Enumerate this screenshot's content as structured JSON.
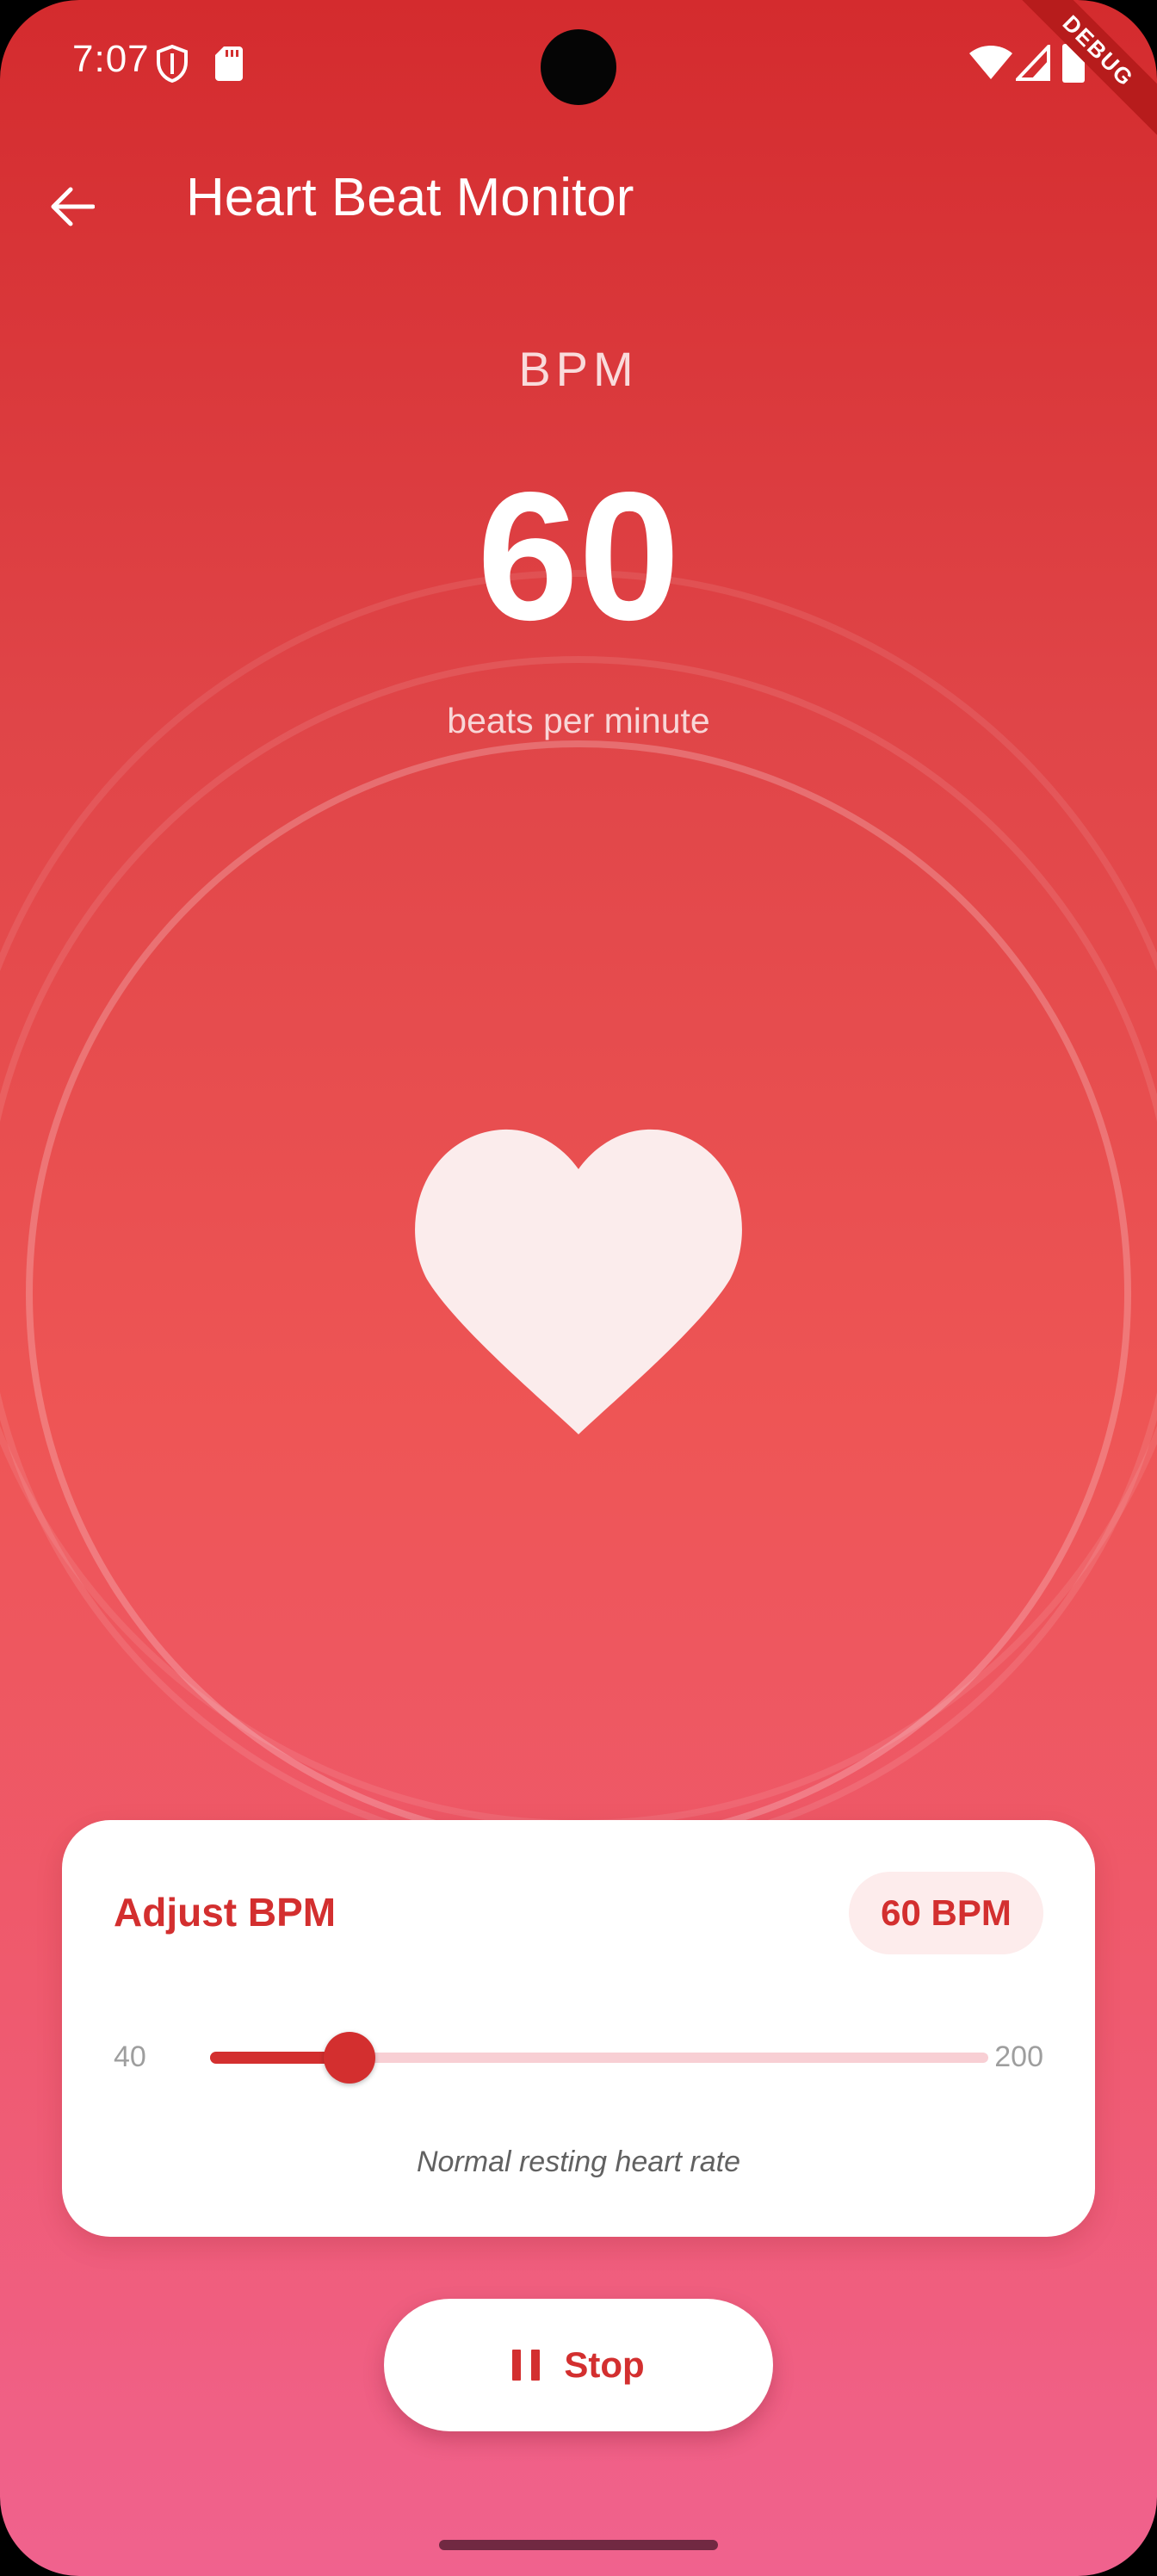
{
  "status_bar": {
    "time": "7:07",
    "debug_label": "DEBUG"
  },
  "app_bar": {
    "title": "Heart Beat Monitor"
  },
  "display": {
    "label": "BPM",
    "value": "60",
    "unit": "beats per minute"
  },
  "card": {
    "title": "Adjust BPM",
    "chip": "60 BPM",
    "slider": {
      "min_label": "40",
      "max_label": "200",
      "min": 40,
      "max": 200,
      "value": 60
    },
    "caption": "Normal resting heart rate"
  },
  "stop_button": {
    "label": "Stop"
  },
  "colors": {
    "accent": "#d32f2f",
    "gradient_top": "#d42b2e",
    "gradient_bottom": "#f0628e",
    "heart": "#fbecec"
  }
}
